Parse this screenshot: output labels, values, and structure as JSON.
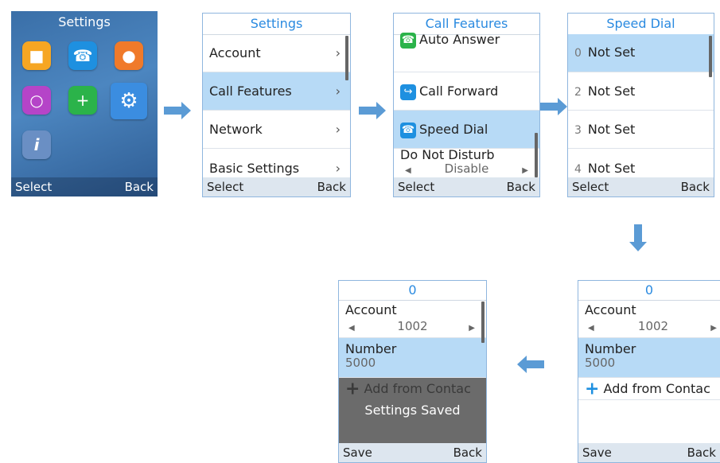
{
  "screens": {
    "home": {
      "title": "Settings",
      "select": "Select",
      "back": "Back",
      "icons": [
        "contacts-icon",
        "call-icon",
        "messages-icon",
        "voicemail-icon",
        "security-icon",
        "settings-gear-icon",
        "info-icon"
      ]
    },
    "settings": {
      "title": "Settings",
      "items": [
        "Account",
        "Call Features",
        "Network",
        "Basic Settings"
      ],
      "select": "Select",
      "back": "Back"
    },
    "call_features": {
      "title": "Call Features",
      "items": [
        "Auto Answer",
        "Call Forward",
        "Speed Dial"
      ],
      "dnd_label": "Do Not Disturb",
      "dnd_value": "Disable",
      "select": "Select",
      "back": "Back"
    },
    "speed_dial": {
      "title": "Speed Dial",
      "entries": [
        {
          "num": "0",
          "label": "Not Set"
        },
        {
          "num": "2",
          "label": "Not Set"
        },
        {
          "num": "3",
          "label": "Not Set"
        },
        {
          "num": "4",
          "label": "Not Set"
        }
      ],
      "select": "Select",
      "back": "Back"
    },
    "edit": {
      "title": "0",
      "account_label": "Account",
      "account_value": "1002",
      "number_label": "Number",
      "number_value": "5000",
      "add_contact": "Add from Contac",
      "save": "Save",
      "back": "Back"
    },
    "saved": {
      "title": "0",
      "account_label": "Account",
      "account_value": "1002",
      "number_label": "Number",
      "number_value": "5000",
      "add_contact": "Add from Contac",
      "toast": "Settings Saved",
      "save": "Save",
      "back": "Back"
    }
  },
  "colors": {
    "accent": "#2a8ae0",
    "selected_row": "#b7daf6",
    "arrow": "#5b9bd5"
  }
}
